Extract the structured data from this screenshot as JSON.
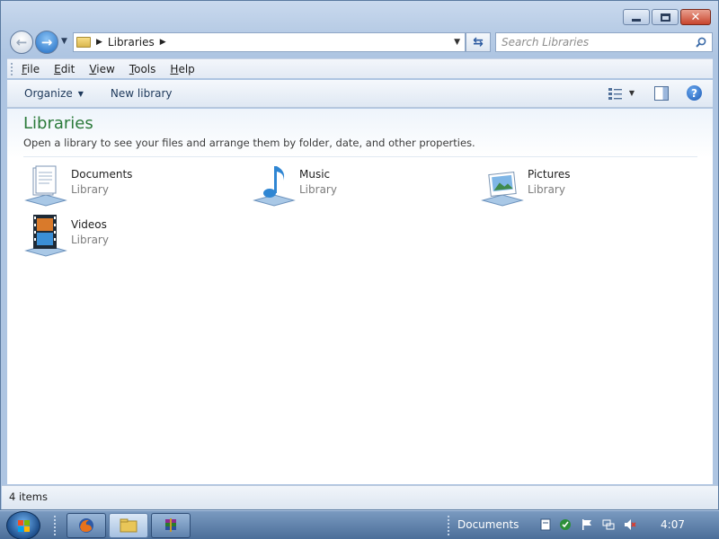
{
  "window": {
    "caption_buttons": {
      "minimize": "minimize-icon",
      "maximize": "maximize-icon",
      "close": "close-icon"
    }
  },
  "address": {
    "path": "Libraries",
    "search_placeholder": "Search Libraries"
  },
  "menu": {
    "items": [
      {
        "label": "File",
        "accel": "F",
        "rest": "ile"
      },
      {
        "label": "Edit",
        "accel": "E",
        "rest": "dit"
      },
      {
        "label": "View",
        "accel": "V",
        "rest": "iew"
      },
      {
        "label": "Tools",
        "accel": "T",
        "rest": "ools"
      },
      {
        "label": "Help",
        "accel": "H",
        "rest": "elp"
      }
    ]
  },
  "toolbar": {
    "organize_label": "Organize",
    "new_library_label": "New library"
  },
  "content": {
    "title": "Libraries",
    "subtitle": "Open a library to see your files and arrange them by folder, date, and other properties.",
    "libraries": [
      {
        "name": "Documents",
        "type": "Library",
        "icon": "documents-library-icon"
      },
      {
        "name": "Music",
        "type": "Library",
        "icon": "music-library-icon"
      },
      {
        "name": "Pictures",
        "type": "Library",
        "icon": "pictures-library-icon"
      },
      {
        "name": "Videos",
        "type": "Library",
        "icon": "videos-library-icon"
      }
    ]
  },
  "status": {
    "item_count": "4 items"
  },
  "taskbar": {
    "pinned": [
      "firefox-icon",
      "explorer-icon",
      "winrar-icon"
    ],
    "toolbar_label": "Documents",
    "clock": "4:07"
  },
  "colors": {
    "title_green": "#2b7a3a",
    "accent_blue": "#1f6cc3",
    "close_red": "#c8452d"
  }
}
